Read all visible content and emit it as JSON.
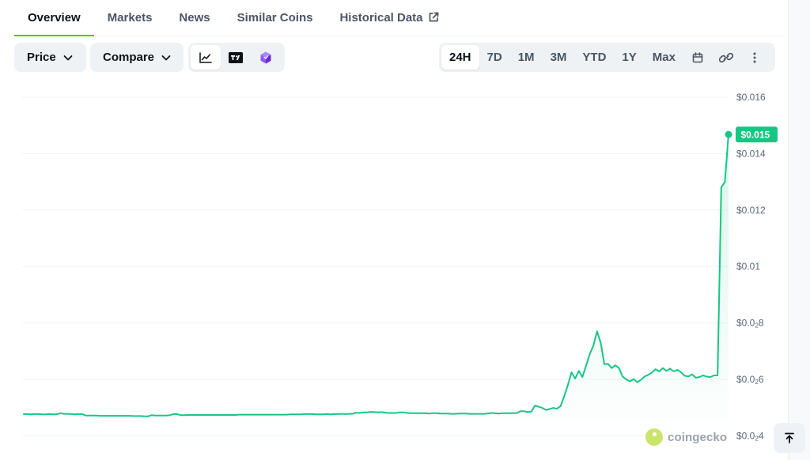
{
  "tabs": [
    {
      "label": "Overview",
      "active": true
    },
    {
      "label": "Markets"
    },
    {
      "label": "News"
    },
    {
      "label": "Similar Coins"
    },
    {
      "label": "Historical Data",
      "external": true
    }
  ],
  "toolbar": {
    "price_label": "Price",
    "compare_label": "Compare",
    "chart_types": [
      {
        "icon": "line-chart-icon",
        "active": true
      },
      {
        "icon": "tradingview-icon"
      },
      {
        "icon": "cube-icon"
      }
    ],
    "ranges": [
      {
        "label": "24H",
        "active": true
      },
      {
        "label": "7D"
      },
      {
        "label": "1M"
      },
      {
        "label": "3M"
      },
      {
        "label": "YTD"
      },
      {
        "label": "1Y"
      },
      {
        "label": "Max"
      }
    ],
    "range_icons": [
      "calendar-icon",
      "link-icon",
      "more-vertical-icon"
    ]
  },
  "chart_data": {
    "type": "line",
    "range": "24H",
    "ylim": [
      0.0039,
      0.0165
    ],
    "y_ticks": [
      {
        "value": 0.016,
        "label": "$0.016"
      },
      {
        "value": 0.014,
        "label": "$0.014"
      },
      {
        "value": 0.012,
        "label": "$0.012"
      },
      {
        "value": 0.01,
        "label": "$0.01"
      },
      {
        "value": 0.008,
        "label_main": "$0.0",
        "label_sub": "2",
        "label_tail": "8"
      },
      {
        "value": 0.006,
        "label_main": "$0.0",
        "label_sub": "2",
        "label_tail": "6"
      },
      {
        "value": 0.004,
        "label_main": "$0.0",
        "label_sub": "2",
        "label_tail": "4"
      }
    ],
    "current_price_label": "$0.015",
    "current_price": 0.01468,
    "line_color": "#16c784",
    "grid": true,
    "series": [
      {
        "values": [
          0.00477,
          0.00477,
          0.00476,
          0.00477,
          0.00477,
          0.00476,
          0.00476,
          0.00477,
          0.00476,
          0.00476,
          0.0048,
          0.00478,
          0.00478,
          0.00477,
          0.00476,
          0.00477,
          0.00477,
          0.00472,
          0.00472,
          0.00472,
          0.00472,
          0.00471,
          0.00471,
          0.00471,
          0.00471,
          0.00471,
          0.00471,
          0.00471,
          0.00471,
          0.00471,
          0.0047,
          0.0047,
          0.0047,
          0.00469,
          0.00469,
          0.00473,
          0.00472,
          0.00472,
          0.00472,
          0.00472,
          0.00473,
          0.00477,
          0.00477,
          0.00473,
          0.00473,
          0.00474,
          0.00474,
          0.00474,
          0.00474,
          0.00474,
          0.00474,
          0.00474,
          0.00474,
          0.00474,
          0.00474,
          0.00474,
          0.00474,
          0.00474,
          0.00474,
          0.00475,
          0.00475,
          0.00475,
          0.00475,
          0.00475,
          0.00475,
          0.00475,
          0.00475,
          0.00475,
          0.00475,
          0.00475,
          0.00475,
          0.00475,
          0.00475,
          0.00476,
          0.00476,
          0.00476,
          0.00476,
          0.00477,
          0.00477,
          0.00477,
          0.00476,
          0.00476,
          0.00476,
          0.00477,
          0.00476,
          0.00477,
          0.00477,
          0.00478,
          0.00477,
          0.00478,
          0.00478,
          0.00482,
          0.00481,
          0.00483,
          0.00483,
          0.00485,
          0.00484,
          0.00483,
          0.00484,
          0.00482,
          0.00481,
          0.00481,
          0.00481,
          0.00483,
          0.00483,
          0.00481,
          0.0048,
          0.0048,
          0.0048,
          0.0048,
          0.0048,
          0.00479,
          0.0048,
          0.0048,
          0.00479,
          0.00479,
          0.00479,
          0.00478,
          0.00478,
          0.00479,
          0.00479,
          0.00479,
          0.00478,
          0.00478,
          0.00478,
          0.00478,
          0.00478,
          0.00479,
          0.00481,
          0.0048,
          0.00479,
          0.0048,
          0.0048,
          0.0048,
          0.0048,
          0.0048,
          0.00487,
          0.00487,
          0.00484,
          0.00486,
          0.00507,
          0.00503,
          0.00499,
          0.00492,
          0.00495,
          0.00499,
          0.00496,
          0.00505,
          0.0054,
          0.0058,
          0.00625,
          0.00603,
          0.0063,
          0.00608,
          0.0065,
          0.0069,
          0.0072,
          0.0077,
          0.0073,
          0.00654,
          0.00655,
          0.0064,
          0.0065,
          0.0064,
          0.0061,
          0.006,
          0.00593,
          0.00601,
          0.0059,
          0.00598,
          0.0061,
          0.00616,
          0.00624,
          0.00636,
          0.00628,
          0.0064,
          0.0063,
          0.00638,
          0.00628,
          0.00634,
          0.00625,
          0.00613,
          0.0061,
          0.00618,
          0.00606,
          0.00608,
          0.00614,
          0.0061,
          0.00608,
          0.00614,
          0.00614,
          0.0128,
          0.013,
          0.01468
        ]
      }
    ]
  },
  "brand": {
    "name": "coingecko"
  }
}
